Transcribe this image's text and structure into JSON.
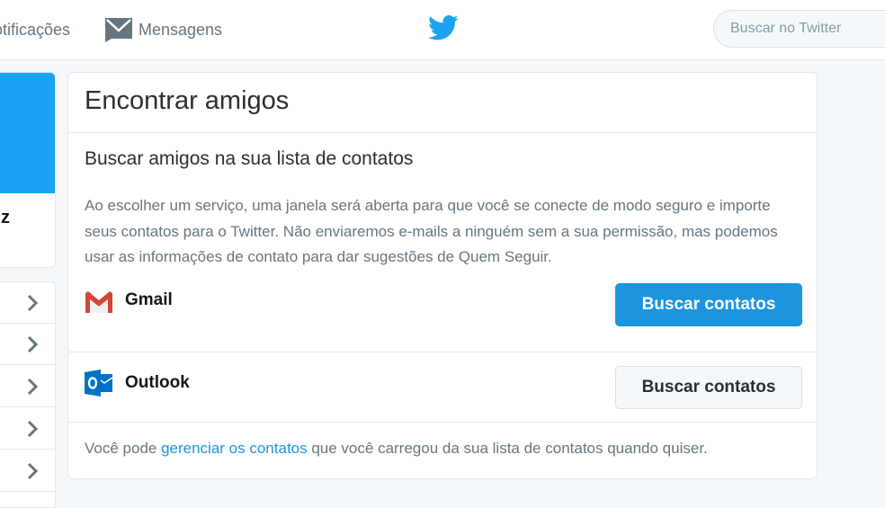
{
  "nav": {
    "notifications_label": "Notificações",
    "messages_label": "Mensagens",
    "search_placeholder": "Buscar no Twitter"
  },
  "sidebar": {
    "profile_name_fragment": "z",
    "banner_color": "#1da1f2",
    "menu_items": 5
  },
  "card": {
    "title": "Encontrar amigos",
    "subtitle": "Buscar amigos na sua lista de contatos",
    "description": "Ao escolher um serviço, uma janela será aberta para que você se conecte de modo seguro e importe seus contatos para o Twitter. Não enviaremos e-mails a ninguém sem a sua permissão, mas podemos usar as informações de contato para dar sugestões de Quem Seguir.",
    "services": [
      {
        "name": "Gmail",
        "icon": "gmail-icon",
        "button_label": "Buscar contatos",
        "style": "primary"
      },
      {
        "name": "Outlook",
        "icon": "outlook-icon",
        "button_label": "Buscar contatos",
        "style": "secondary"
      }
    ],
    "footer": {
      "before": "Você pode ",
      "link": "gerenciar os contatos",
      "after": " que você carregou da sua lista de contatos quando quiser."
    }
  },
  "colors": {
    "accent": "#1b95e0",
    "twitter_blue": "#1da1f2",
    "muted_text": "#66757f"
  }
}
